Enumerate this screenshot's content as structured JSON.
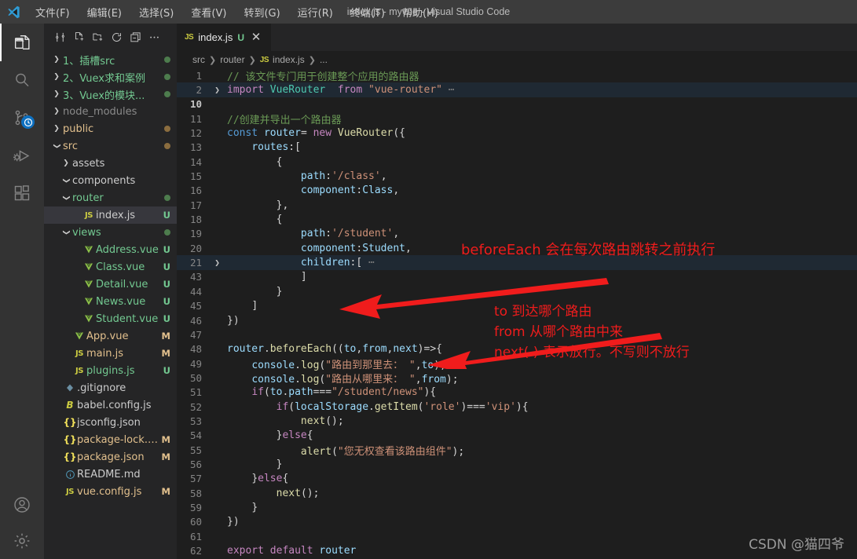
{
  "titlebar": {
    "logo_icon": "vscode-logo-icon",
    "window_title": "index.js - myvue - Visual Studio Code",
    "menu": [
      {
        "label": "文件(F)",
        "name": "menu-file"
      },
      {
        "label": "编辑(E)",
        "name": "menu-edit"
      },
      {
        "label": "选择(S)",
        "name": "menu-selection"
      },
      {
        "label": "查看(V)",
        "name": "menu-view"
      },
      {
        "label": "转到(G)",
        "name": "menu-go"
      },
      {
        "label": "运行(R)",
        "name": "menu-run"
      },
      {
        "label": "终端(T)",
        "name": "menu-terminal"
      },
      {
        "label": "帮助(H)",
        "name": "menu-help"
      }
    ]
  },
  "activitybar": {
    "top": [
      {
        "icon": "explorer-icon",
        "name": "activity-explorer",
        "active": true
      },
      {
        "icon": "search-icon",
        "name": "activity-search",
        "active": false
      },
      {
        "icon": "source-control-icon",
        "name": "activity-source-control",
        "active": false,
        "badge": "clock-badge-icon"
      },
      {
        "icon": "run-debug-icon",
        "name": "activity-run-debug",
        "active": false
      },
      {
        "icon": "extensions-icon",
        "name": "activity-extensions",
        "active": false
      }
    ],
    "bottom": [
      {
        "icon": "account-icon",
        "name": "activity-account"
      },
      {
        "icon": "gear-icon",
        "name": "activity-manage-settings"
      }
    ]
  },
  "sidebar": {
    "toolbar": [
      {
        "icon": "explorer-title-icon",
        "name": "explorer-view-icon"
      },
      {
        "icon": "new-file-icon",
        "name": "new-file-button"
      },
      {
        "icon": "new-folder-icon",
        "name": "new-folder-button"
      },
      {
        "icon": "refresh-icon",
        "name": "refresh-explorer-button"
      },
      {
        "icon": "collapse-all-icon",
        "name": "collapse-folders-button"
      },
      {
        "icon": "more-actions-icon",
        "name": "more-actions-button"
      }
    ],
    "tree": [
      {
        "indent": 0,
        "chevron": "right",
        "label": "1、插槽src",
        "color": "#73c991",
        "icon": "",
        "badge": "",
        "dot": "#4d7c4d"
      },
      {
        "indent": 0,
        "chevron": "right",
        "label": "2、Vuex求和案例",
        "color": "#73c991",
        "icon": "",
        "badge": "",
        "dot": "#4d7c4d"
      },
      {
        "indent": 0,
        "chevron": "right",
        "label": "3、Vuex的模块...",
        "color": "#73c991",
        "icon": "",
        "badge": "",
        "dot": "#4d7c4d"
      },
      {
        "indent": 0,
        "chevron": "right",
        "label": "node_modules",
        "color": "#8a8a8a",
        "icon": "",
        "badge": "",
        "dot": ""
      },
      {
        "indent": 0,
        "chevron": "right",
        "label": "public",
        "color": "#e2c08d",
        "icon": "",
        "badge": "",
        "dot": "#8b6d3f"
      },
      {
        "indent": 0,
        "chevron": "down",
        "label": "src",
        "color": "#e2c08d",
        "icon": "",
        "badge": "",
        "dot": "#8b6d3f"
      },
      {
        "indent": 1,
        "chevron": "right",
        "label": "assets",
        "color": "#cccccc",
        "icon": "",
        "badge": "",
        "dot": ""
      },
      {
        "indent": 1,
        "chevron": "down",
        "label": "components",
        "color": "#cccccc",
        "icon": "",
        "badge": "",
        "dot": ""
      },
      {
        "indent": 1,
        "chevron": "down",
        "label": "router",
        "color": "#73c991",
        "icon": "",
        "badge": "",
        "dot": "#4d7c4d"
      },
      {
        "indent": 2,
        "chevron": "none",
        "label": "index.js",
        "color": "#cccccc",
        "icon": "js",
        "badge": "U",
        "badge_color": "#73c991",
        "dot": "",
        "selected": true
      },
      {
        "indent": 1,
        "chevron": "down",
        "label": "views",
        "color": "#73c991",
        "icon": "",
        "badge": "",
        "dot": "#4d7c4d"
      },
      {
        "indent": 2,
        "chevron": "none",
        "label": "Address.vue",
        "color": "#73c991",
        "icon": "vue",
        "badge": "U",
        "badge_color": "#73c991",
        "dot": ""
      },
      {
        "indent": 2,
        "chevron": "none",
        "label": "Class.vue",
        "color": "#73c991",
        "icon": "vue",
        "badge": "U",
        "badge_color": "#73c991",
        "dot": ""
      },
      {
        "indent": 2,
        "chevron": "none",
        "label": "Detail.vue",
        "color": "#73c991",
        "icon": "vue",
        "badge": "U",
        "badge_color": "#73c991",
        "dot": ""
      },
      {
        "indent": 2,
        "chevron": "none",
        "label": "News.vue",
        "color": "#73c991",
        "icon": "vue",
        "badge": "U",
        "badge_color": "#73c991",
        "dot": ""
      },
      {
        "indent": 2,
        "chevron": "none",
        "label": "Student.vue",
        "color": "#73c991",
        "icon": "vue",
        "badge": "U",
        "badge_color": "#73c991",
        "dot": ""
      },
      {
        "indent": 1,
        "chevron": "none",
        "label": "App.vue",
        "color": "#e2c08d",
        "icon": "vue",
        "badge": "M",
        "badge_color": "#e2c08d",
        "dot": ""
      },
      {
        "indent": 1,
        "chevron": "none",
        "label": "main.js",
        "color": "#e2c08d",
        "icon": "js",
        "badge": "M",
        "badge_color": "#e2c08d",
        "dot": ""
      },
      {
        "indent": 1,
        "chevron": "none",
        "label": "plugins.js",
        "color": "#73c991",
        "icon": "js",
        "badge": "U",
        "badge_color": "#73c991",
        "dot": ""
      },
      {
        "indent": 0,
        "chevron": "none",
        "label": ".gitignore",
        "color": "#cccccc",
        "icon": "git",
        "badge": "",
        "dot": ""
      },
      {
        "indent": 0,
        "chevron": "none",
        "label": "babel.config.js",
        "color": "#cccccc",
        "icon": "babel",
        "badge": "",
        "dot": ""
      },
      {
        "indent": 0,
        "chevron": "none",
        "label": "jsconfig.json",
        "color": "#cccccc",
        "icon": "json",
        "badge": "",
        "dot": ""
      },
      {
        "indent": 0,
        "chevron": "none",
        "label": "package-lock.json",
        "color": "#e2c08d",
        "icon": "json",
        "badge": "M",
        "badge_color": "#e2c08d",
        "dot": ""
      },
      {
        "indent": 0,
        "chevron": "none",
        "label": "package.json",
        "color": "#e2c08d",
        "icon": "json",
        "badge": "M",
        "badge_color": "#e2c08d",
        "dot": ""
      },
      {
        "indent": 0,
        "chevron": "none",
        "label": "README.md",
        "color": "#cccccc",
        "icon": "info",
        "badge": "",
        "dot": ""
      },
      {
        "indent": 0,
        "chevron": "none",
        "label": "vue.config.js",
        "color": "#e2c08d",
        "icon": "js",
        "badge": "M",
        "badge_color": "#e2c08d",
        "dot": ""
      }
    ]
  },
  "editor": {
    "tab": {
      "icon": "js-file-icon",
      "title": "index.js",
      "badge": "U",
      "close_icon": "close-icon"
    },
    "breadcrumbs": [
      "src",
      "router",
      "index.js",
      "..."
    ],
    "breadcrumb_file_icon": "js-file-icon",
    "lines": [
      {
        "n": "1",
        "fold": "",
        "hl": false,
        "cur": false,
        "html": "<span class='c-com'>// 该文件专门用于创建整个应用的路由器</span>"
      },
      {
        "n": "2",
        "fold": "▼",
        "hl": true,
        "cur": false,
        "html": "<span class='c-key'>import</span> <span class='c-cls'>VueRouter</span>  <span class='c-key'>from</span> <span class='c-str'>\"vue-router\"</span><span class='c-ell'> ⋯</span>"
      },
      {
        "n": "10",
        "fold": "",
        "hl": false,
        "cur": true,
        "html": ""
      },
      {
        "n": "11",
        "fold": "",
        "hl": false,
        "cur": false,
        "html": "<span class='c-com'>//创建并导出一个路由器</span>"
      },
      {
        "n": "12",
        "fold": "",
        "hl": false,
        "cur": false,
        "html": "<span class='c-kw2'>const</span> <span class='c-var'>router</span><span class='c-pun'>=</span> <span class='c-key'>new</span> <span class='c-fn'>VueRouter</span><span class='c-pun'>({</span>"
      },
      {
        "n": "13",
        "fold": "",
        "hl": false,
        "cur": false,
        "html": "    <span class='c-var'>routes</span><span class='c-pun'>:[</span>"
      },
      {
        "n": "14",
        "fold": "",
        "hl": false,
        "cur": false,
        "html": "        <span class='c-pun'>{</span>"
      },
      {
        "n": "15",
        "fold": "",
        "hl": false,
        "cur": false,
        "html": "            <span class='c-var'>path</span><span class='c-pun'>:</span><span class='c-str'>'/class'</span><span class='c-pun'>,</span>"
      },
      {
        "n": "16",
        "fold": "",
        "hl": false,
        "cur": false,
        "html": "            <span class='c-var'>component</span><span class='c-pun'>:</span><span class='c-var'>Class</span><span class='c-pun'>,</span>"
      },
      {
        "n": "17",
        "fold": "",
        "hl": false,
        "cur": false,
        "html": "        <span class='c-pun'>},</span>"
      },
      {
        "n": "18",
        "fold": "",
        "hl": false,
        "cur": false,
        "html": "        <span class='c-pun'>{</span>"
      },
      {
        "n": "19",
        "fold": "",
        "hl": false,
        "cur": false,
        "html": "            <span class='c-var'>path</span><span class='c-pun'>:</span><span class='c-str'>'/student'</span><span class='c-pun'>,</span>"
      },
      {
        "n": "20",
        "fold": "",
        "hl": false,
        "cur": false,
        "html": "            <span class='c-var'>component</span><span class='c-pun'>:</span><span class='c-var'>Student</span><span class='c-pun'>,</span>"
      },
      {
        "n": "21",
        "fold": "▼",
        "hl": true,
        "cur": false,
        "html": "            <span class='c-var'>children</span><span class='c-pun'>:[</span><span class='c-ell'> ⋯</span>"
      },
      {
        "n": "43",
        "fold": "",
        "hl": false,
        "cur": false,
        "html": "            <span class='c-pun'>]</span>"
      },
      {
        "n": "44",
        "fold": "",
        "hl": false,
        "cur": false,
        "html": "        <span class='c-pun'>}</span>"
      },
      {
        "n": "45",
        "fold": "",
        "hl": false,
        "cur": false,
        "html": "    <span class='c-pun'>]</span>"
      },
      {
        "n": "46",
        "fold": "",
        "hl": false,
        "cur": false,
        "html": "<span class='c-pun'>})</span>"
      },
      {
        "n": "47",
        "fold": "",
        "hl": false,
        "cur": false,
        "html": ""
      },
      {
        "n": "48",
        "fold": "",
        "hl": false,
        "cur": false,
        "html": "<span class='c-var'>router</span><span class='c-pun'>.</span><span class='c-fn'>beforeEach</span><span class='c-pun'>((</span><span class='c-var'>to</span><span class='c-pun'>,</span><span class='c-var'>from</span><span class='c-pun'>,</span><span class='c-var'>next</span><span class='c-pun'>)=>{</span>"
      },
      {
        "n": "49",
        "fold": "",
        "hl": false,
        "cur": false,
        "html": "    <span class='c-var'>console</span><span class='c-pun'>.</span><span class='c-fn'>log</span><span class='c-pun'>(</span><span class='c-str'>\"路由到那里去： \"</span><span class='c-pun'>,</span><span class='c-var'>to</span><span class='c-pun'>);</span>"
      },
      {
        "n": "50",
        "fold": "",
        "hl": false,
        "cur": false,
        "html": "    <span class='c-var'>console</span><span class='c-pun'>.</span><span class='c-fn'>log</span><span class='c-pun'>(</span><span class='c-str'>\"路由从哪里来： \"</span><span class='c-pun'>,</span><span class='c-var'>from</span><span class='c-pun'>);</span>"
      },
      {
        "n": "51",
        "fold": "",
        "hl": false,
        "cur": false,
        "html": "    <span class='c-key'>if</span><span class='c-pun'>(</span><span class='c-var'>to</span><span class='c-pun'>.</span><span class='c-var'>path</span><span class='c-pun'>===</span><span class='c-str'>\"/student/news\"</span><span class='c-pun'>){</span>"
      },
      {
        "n": "52",
        "fold": "",
        "hl": false,
        "cur": false,
        "html": "        <span class='c-key'>if</span><span class='c-pun'>(</span><span class='c-var'>localStorage</span><span class='c-pun'>.</span><span class='c-fn'>getItem</span><span class='c-pun'>(</span><span class='c-str'>'role'</span><span class='c-pun'>)===</span><span class='c-str'>'vip'</span><span class='c-pun'>){</span>"
      },
      {
        "n": "53",
        "fold": "",
        "hl": false,
        "cur": false,
        "html": "            <span class='c-fn'>next</span><span class='c-pun'>();</span>"
      },
      {
        "n": "54",
        "fold": "",
        "hl": false,
        "cur": false,
        "html": "        <span class='c-pun'>}</span><span class='c-key'>else</span><span class='c-pun'>{</span>"
      },
      {
        "n": "55",
        "fold": "",
        "hl": false,
        "cur": false,
        "html": "            <span class='c-fn'>alert</span><span class='c-pun'>(</span><span class='c-str'>\"您无权查看该路由组件\"</span><span class='c-pun'>);</span>"
      },
      {
        "n": "56",
        "fold": "",
        "hl": false,
        "cur": false,
        "html": "        <span class='c-pun'>}</span>"
      },
      {
        "n": "57",
        "fold": "",
        "hl": false,
        "cur": false,
        "html": "    <span class='c-pun'>}</span><span class='c-key'>else</span><span class='c-pun'>{</span>"
      },
      {
        "n": "58",
        "fold": "",
        "hl": false,
        "cur": false,
        "html": "        <span class='c-fn'>next</span><span class='c-pun'>();</span>"
      },
      {
        "n": "59",
        "fold": "",
        "hl": false,
        "cur": false,
        "html": "    <span class='c-pun'>}</span>"
      },
      {
        "n": "60",
        "fold": "",
        "hl": false,
        "cur": false,
        "html": "<span class='c-pun'>})</span>"
      },
      {
        "n": "61",
        "fold": "",
        "hl": false,
        "cur": false,
        "html": ""
      },
      {
        "n": "62",
        "fold": "",
        "hl": false,
        "cur": false,
        "html": "<span class='c-key'>export</span> <span class='c-key'>default</span> <span class='c-var'>router</span>"
      }
    ]
  },
  "annotations": {
    "note_beforeeach": "beforeEach 会在每次路由跳转之前执行",
    "note_to": "to 到达哪个路由",
    "note_from": "from  从哪个路由中来",
    "note_next": "next( ) 表示放行。不写则不放行",
    "arrow_to_foldline": "red-arrow-icon",
    "arrow_to_router": "red-arrow-icon",
    "arrow_to_log": "red-arrow-icon"
  },
  "watermark": {
    "text": "CSDN @猫四爷"
  },
  "colors": {
    "accent_blue": "#0e70c0",
    "annotation_red": "#f01c1c",
    "badge_untracked_green": "#73c991",
    "badge_modified_yellow": "#e2c08d",
    "editor_bg": "#1e1e1e",
    "sidebar_bg": "#252526",
    "activitybar_bg": "#333333",
    "titlebar_bg": "#3c3c3c"
  }
}
